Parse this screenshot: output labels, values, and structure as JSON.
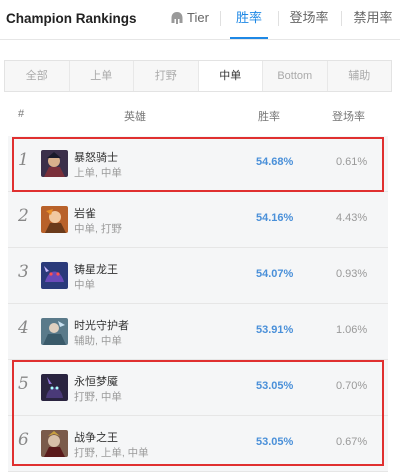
{
  "header": {
    "title": "Champion Rankings",
    "tabs": [
      {
        "label": "Tier",
        "icon": "helmet-icon"
      },
      {
        "label": "胜率",
        "active": true
      },
      {
        "label": "登场率"
      },
      {
        "label": "禁用率"
      }
    ]
  },
  "positions": [
    {
      "label": "全部"
    },
    {
      "label": "上单"
    },
    {
      "label": "打野"
    },
    {
      "label": "中单",
      "active": true
    },
    {
      "label": "Bottom"
    },
    {
      "label": "辅助"
    }
  ],
  "columns": {
    "rank": "#",
    "hero": "英雄",
    "winrate": "胜率",
    "pickrate": "登场率"
  },
  "rows": [
    {
      "rank": "1",
      "name": "暴怒骑士",
      "roles": "上单, 中单",
      "winrate": "54.68%",
      "pickrate": "0.61%",
      "avatar_color": "#3b2f4a"
    },
    {
      "rank": "2",
      "name": "岩雀",
      "roles": "中单, 打野",
      "winrate": "54.16%",
      "pickrate": "4.43%",
      "avatar_color": "#b8612a"
    },
    {
      "rank": "3",
      "name": "铸星龙王",
      "roles": "中单",
      "winrate": "54.07%",
      "pickrate": "0.93%",
      "avatar_color": "#2a3a7a"
    },
    {
      "rank": "4",
      "name": "时光守护者",
      "roles": "辅助, 中单",
      "winrate": "53.91%",
      "pickrate": "1.06%",
      "avatar_color": "#5a7a8a"
    },
    {
      "rank": "5",
      "name": "永恒梦魇",
      "roles": "打野, 中单",
      "winrate": "53.05%",
      "pickrate": "0.70%",
      "avatar_color": "#2a2440"
    },
    {
      "rank": "6",
      "name": "战争之王",
      "roles": "打野, 上单, 中单",
      "winrate": "53.05%",
      "pickrate": "0.67%",
      "avatar_color": "#7a5a4a"
    }
  ],
  "colors": {
    "accent": "#1e88e5",
    "winrate": "#4a90d9",
    "highlight": "#e03030"
  }
}
